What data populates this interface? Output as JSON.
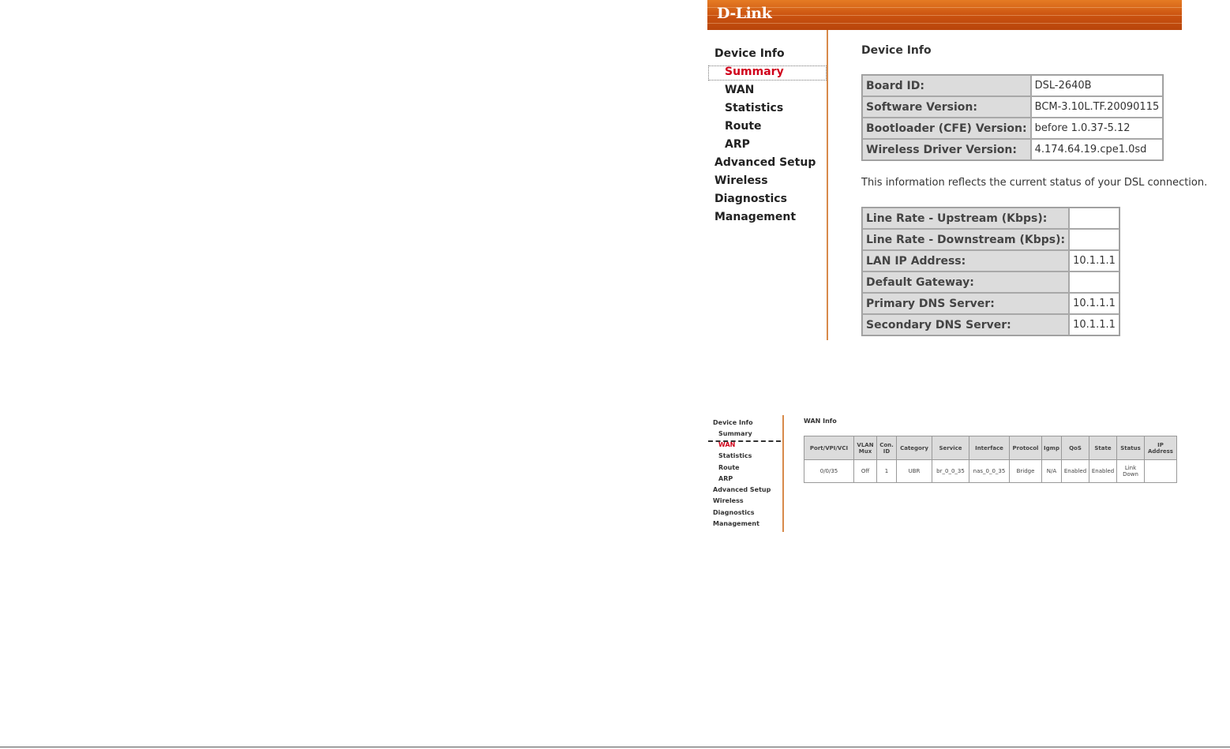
{
  "top": {
    "logo": "D-Link",
    "sidebar": [
      {
        "label": "Device Info",
        "sub": false,
        "active": false
      },
      {
        "label": "Summary",
        "sub": true,
        "active": true
      },
      {
        "label": "WAN",
        "sub": true,
        "active": false
      },
      {
        "label": "Statistics",
        "sub": true,
        "active": false
      },
      {
        "label": "Route",
        "sub": true,
        "active": false
      },
      {
        "label": "ARP",
        "sub": true,
        "active": false
      },
      {
        "label": "Advanced Setup",
        "sub": false,
        "active": false
      },
      {
        "label": "Wireless",
        "sub": false,
        "active": false
      },
      {
        "label": "Diagnostics",
        "sub": false,
        "active": false
      },
      {
        "label": "Management",
        "sub": false,
        "active": false
      }
    ],
    "title": "Device Info",
    "device_table": [
      {
        "label": "Board ID:",
        "value": "DSL-2640B"
      },
      {
        "label": "Software Version:",
        "value": "BCM-3.10L.TF.20090115"
      },
      {
        "label": "Bootloader (CFE) Version:",
        "value": "before 1.0.37-5.12"
      },
      {
        "label": "Wireless Driver Version:",
        "value": "4.174.64.19.cpe1.0sd"
      }
    ],
    "note": "This information reflects the current status of your DSL connection.",
    "status_table": [
      {
        "label": "Line Rate - Upstream (Kbps):",
        "value": ""
      },
      {
        "label": "Line Rate - Downstream (Kbps):",
        "value": ""
      },
      {
        "label": "LAN IP Address:",
        "value": "10.1.1.1"
      },
      {
        "label": "Default Gateway:",
        "value": ""
      },
      {
        "label": "Primary DNS Server:",
        "value": "10.1.1.1"
      },
      {
        "label": "Secondary DNS Server:",
        "value": "10.1.1.1"
      }
    ]
  },
  "bottom": {
    "sidebar": [
      {
        "label": "Device Info",
        "sub": false,
        "active": false
      },
      {
        "label": "Summary",
        "sub": true,
        "active": false
      },
      {
        "label": "WAN",
        "sub": true,
        "active": true
      },
      {
        "label": "Statistics",
        "sub": true,
        "active": false
      },
      {
        "label": "Route",
        "sub": true,
        "active": false
      },
      {
        "label": "ARP",
        "sub": true,
        "active": false
      },
      {
        "label": "Advanced Setup",
        "sub": false,
        "active": false
      },
      {
        "label": "Wireless",
        "sub": false,
        "active": false
      },
      {
        "label": "Diagnostics",
        "sub": false,
        "active": false
      },
      {
        "label": "Management",
        "sub": false,
        "active": false
      }
    ],
    "title": "WAN Info",
    "table": {
      "headers": [
        "Port/VPI/VCI",
        "VLAN Mux",
        "Con. ID",
        "Category",
        "Service",
        "Interface",
        "Protocol",
        "Igmp",
        "QoS",
        "State",
        "Status",
        "IP Address"
      ],
      "rows": [
        [
          "0/0/35",
          "Off",
          "1",
          "UBR",
          "br_0_0_35",
          "nas_0_0_35",
          "Bridge",
          "N/A",
          "Enabled",
          "Enabled",
          "Link Down",
          ""
        ]
      ]
    }
  },
  "colors": {
    "banner": "#c9500f",
    "active_link": "#d0021b",
    "label_bg": "#dcdcdc",
    "sidebar_border": "#d88a4a"
  }
}
